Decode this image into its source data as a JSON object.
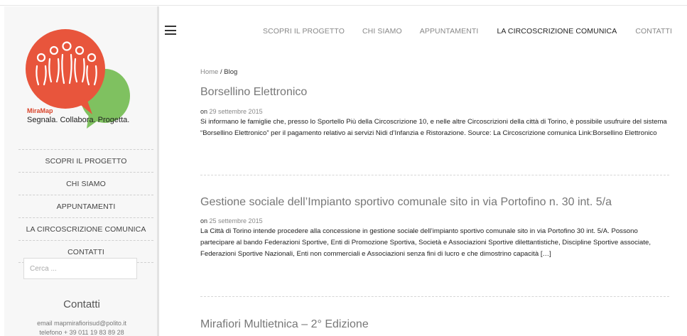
{
  "logo": {
    "brand": "MiraMap",
    "tagline": "Segnala. Collabora. Progetta.",
    "colors": {
      "red": "#e8553c",
      "green": "#7fc160"
    }
  },
  "sidebar": {
    "nav": [
      {
        "label": "SCOPRI IL PROGETTO"
      },
      {
        "label": "CHI SIAMO"
      },
      {
        "label": "APPUNTAMENTI"
      },
      {
        "label": "LA CIRCOSCRIZIONE COMUNICA"
      },
      {
        "label": "CONTATTI"
      }
    ],
    "search_placeholder": "Cerca ...",
    "contatti": {
      "title": "Contatti",
      "email": "email mapmirafiorisud@polito.it",
      "phone": "telefono + 39 011 19 83 89 28"
    }
  },
  "topnav": {
    "items": [
      {
        "label": "SCOPRI IL PROGETTO",
        "active": false
      },
      {
        "label": "CHI SIAMO",
        "active": false
      },
      {
        "label": "APPUNTAMENTI",
        "active": false
      },
      {
        "label": "LA CIRCOSCRIZIONE COMUNICA",
        "active": true
      },
      {
        "label": "CONTATTI",
        "active": false
      }
    ]
  },
  "breadcrumb": {
    "home": "Home",
    "separator": " / ",
    "current": "Blog"
  },
  "posts": [
    {
      "title": "Borsellino Elettronico",
      "on": "on",
      "date": "29 settembre 2015",
      "excerpt": "Si informano le famiglie che, presso lo Sportello Più della Circoscrizione 10, e nelle altre Circoscrizioni della città di Torino, è possibile usufruire del sistema “Borsellino Elettronico” per il pagamento relativo ai servizi Nidi d’Infanzia e Ristorazione. Source: La Circoscrizione comunica Link:Borsellino Elettronico"
    },
    {
      "title": "Gestione sociale dell’Impianto sportivo comunale sito in via Portofino n. 30 int. 5/a",
      "on": "on",
      "date": "25 settembre 2015",
      "excerpt": "La Città di Torino intende procedere alla concessione in gestione sociale dell’impianto sportivo comunale sito in via Portofino 30 int. 5/A. Possono partecipare al bando Federazioni Sportive, Enti di Promozione Sportiva, Società e Associazioni Sportive dilettantistiche, Discipline Sportive associate, Federazioni Sportive Nazionali, Enti non commerciali e Associazioni senza fini di lucro e che dimostrino capacità […]"
    },
    {
      "title": "Mirafiori Multietnica – 2° Edizione"
    }
  ]
}
